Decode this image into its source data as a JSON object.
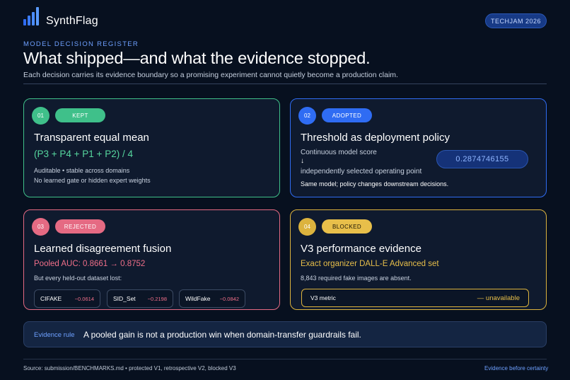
{
  "header": {
    "brand": "SynthFlag",
    "badge": "TECHJAM 2026",
    "eyebrow": "MODEL DECISION REGISTER",
    "title": "What shipped—and what the evidence stopped.",
    "subtitle": "Each decision carries its evidence boundary so a promising experiment cannot quietly become a production claim."
  },
  "cards": [
    {
      "number": "01",
      "status": "KEPT",
      "title": "Transparent equal mean",
      "formula": "(P3 + P4 + P1 + P2) / 4",
      "lines": [
        "Auditable • stable across domains",
        "No learned gate or hidden expert weights"
      ]
    },
    {
      "number": "02",
      "status": "ADOPTED",
      "title": "Threshold as deployment policy",
      "line1": "Continuous model score",
      "arrow": "↓",
      "line2": "independently selected operating point",
      "threshold": "0.2874746155",
      "note": "Same model; policy changes downstream decisions."
    },
    {
      "number": "03",
      "status": "REJECTED",
      "title": "Learned disagreement fusion",
      "pooled": "Pooled AUC: 0.8661 → 0.8752",
      "lost_line": "But every held-out dataset lost:",
      "datasets": [
        {
          "name": "CIFAKE",
          "delta": "−0.0614"
        },
        {
          "name": "SID_Set",
          "delta": "−0.2198"
        },
        {
          "name": "WildFake",
          "delta": "−0.0842"
        }
      ]
    },
    {
      "number": "04",
      "status": "BLOCKED",
      "title": "V3 performance evidence",
      "accent": "Exact organizer DALL-E Advanced set",
      "line": "8,843 required fake images are absent.",
      "metric_name": "V3 metric",
      "metric_value": "— unavailable"
    }
  ],
  "evidence": {
    "label": "Evidence rule",
    "text": "A pooled gain is not a production win when domain-transfer guardrails fail."
  },
  "footer": {
    "source": "Source: submission/BENCHMARKS.md • protected V1, retrospective V2, blocked V3",
    "tagline": "Evidence before certainty"
  },
  "colors": {
    "background": "#07101f",
    "kept": "#3fc08a",
    "adopted": "#2f6cf3",
    "rejected": "#e56a83",
    "blocked": "#dcb33e",
    "link": "#6ea0ff"
  },
  "icons": {
    "logo": "bar-chart-logo-icon",
    "arrow": "arrow-down-icon"
  }
}
